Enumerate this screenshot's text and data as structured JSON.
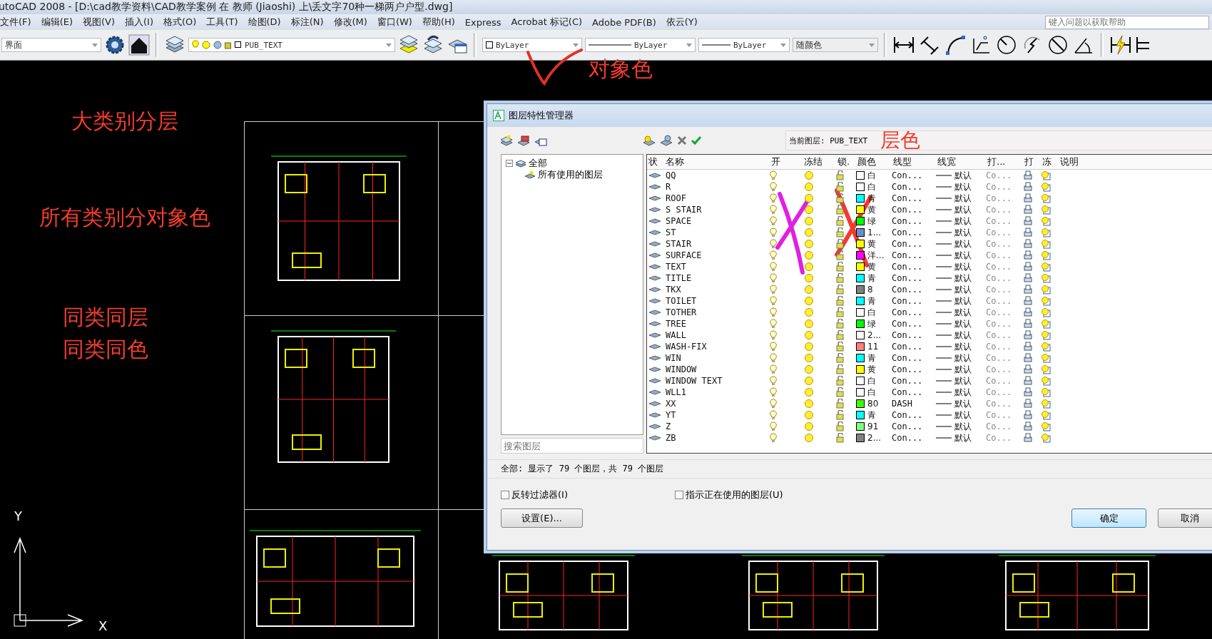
{
  "window": {
    "title": "utoCAD 2008 - [D:\\cad教学资料\\CAD教学案例 在 教师 (Jiaoshi) 上\\丢文字70种一梯两户户型.dwg]"
  },
  "menu": [
    "文件(F)",
    "编辑(E)",
    "视图(V)",
    "插入(I)",
    "格式(O)",
    "工具(T)",
    "绘图(D)",
    "标注(N)",
    "修改(M)",
    "窗口(W)",
    "帮助(H)",
    "Express",
    "Acrobat 标记(C)",
    "Adobe PDF(B)",
    "依云(Y)"
  ],
  "help_search": {
    "placeholder": "键入问题以获取帮助"
  },
  "toolbar": {
    "workspace": "界面",
    "layer": "PUB_TEXT",
    "color_setting": "ByLayer",
    "linetype": "ByLayer",
    "lineweight": "ByLayer",
    "plot_style": "随颜色"
  },
  "annotations": {
    "object_color": "对象色",
    "layer_color": "层色",
    "by_category": "大类别分层",
    "all_by_object_color": "所有类别分对象色",
    "same_layer": "同类同层",
    "same_color": "同类同色"
  },
  "ucs": {
    "x": "X",
    "y": "Y"
  },
  "dialog": {
    "title": "图层特性管理器",
    "current_layer": "当前图层: PUB_TEXT",
    "tree": [
      {
        "label": "全部",
        "expanded": true,
        "children": [
          {
            "label": "所有使用的图层"
          }
        ]
      }
    ],
    "search": {
      "placeholder": "搜索图层"
    },
    "columns": [
      "状",
      "名称",
      "开",
      "冻结",
      "锁.",
      "颜色",
      "线型",
      "线宽",
      "打...",
      "打",
      "冻",
      "说明"
    ],
    "layers": [
      {
        "name": "QQ",
        "color": "#ffffff",
        "color_name": "白",
        "linetype": "Con...",
        "lineweight": "默认",
        "plot_style": "Co..."
      },
      {
        "name": "R",
        "color": "#ffffff",
        "color_name": "白",
        "linetype": "Con...",
        "lineweight": "默认",
        "plot_style": "Co..."
      },
      {
        "name": "ROOF",
        "color": "#00ffff",
        "color_name": "青",
        "linetype": "Con...",
        "lineweight": "默认",
        "plot_style": "Co..."
      },
      {
        "name": "S STAIR",
        "color": "#ffff00",
        "color_name": "黄",
        "linetype": "Con...",
        "lineweight": "默认",
        "plot_style": "Co..."
      },
      {
        "name": "SPACE",
        "color": "#00ff00",
        "color_name": "绿",
        "linetype": "Con...",
        "lineweight": "默认",
        "plot_style": "Co..."
      },
      {
        "name": "ST",
        "color": "#6a8fc8",
        "color_name": "1...",
        "linetype": "Con...",
        "lineweight": "默认",
        "plot_style": "Co..."
      },
      {
        "name": "STAIR",
        "color": "#ffff00",
        "color_name": "黄",
        "linetype": "Con...",
        "lineweight": "默认",
        "plot_style": "Co..."
      },
      {
        "name": "SURFACE",
        "color": "#ff00ff",
        "color_name": "洋...",
        "linetype": "Con...",
        "lineweight": "默认",
        "plot_style": "Co..."
      },
      {
        "name": "TEXT",
        "color": "#ffff00",
        "color_name": "黄",
        "linetype": "Con...",
        "lineweight": "默认",
        "plot_style": "Co..."
      },
      {
        "name": "TITLE",
        "color": "#00ffff",
        "color_name": "青",
        "linetype": "Con...",
        "lineweight": "默认",
        "plot_style": "Co..."
      },
      {
        "name": "TKX",
        "color": "#808080",
        "color_name": "8",
        "linetype": "Con...",
        "lineweight": "默认",
        "plot_style": "Co..."
      },
      {
        "name": "TOILET",
        "color": "#00ffff",
        "color_name": "青",
        "linetype": "Con...",
        "lineweight": "默认",
        "plot_style": "Co..."
      },
      {
        "name": "TOTHER",
        "color": "#ffffff",
        "color_name": "白",
        "linetype": "Con...",
        "lineweight": "默认",
        "plot_style": "Co..."
      },
      {
        "name": "TREE",
        "color": "#00ff00",
        "color_name": "绿",
        "linetype": "Con...",
        "lineweight": "默认",
        "plot_style": "Co..."
      },
      {
        "name": "WALL",
        "color": "#ffffff",
        "color_name": "2...",
        "linetype": "Con...",
        "lineweight": "默认",
        "plot_style": "Co..."
      },
      {
        "name": "WASH-FIX",
        "color": "#ff7f7f",
        "color_name": "11",
        "linetype": "Con...",
        "lineweight": "默认",
        "plot_style": "Co..."
      },
      {
        "name": "WIN",
        "color": "#00ffff",
        "color_name": "青",
        "linetype": "Con...",
        "lineweight": "默认",
        "plot_style": "Co..."
      },
      {
        "name": "WINDOW",
        "color": "#ffff00",
        "color_name": "黄",
        "linetype": "Con...",
        "lineweight": "默认",
        "plot_style": "Co..."
      },
      {
        "name": "WINDOW TEXT",
        "color": "#ffffff",
        "color_name": "白",
        "linetype": "Con...",
        "lineweight": "默认",
        "plot_style": "Co..."
      },
      {
        "name": "WLL1",
        "color": "#ffffff",
        "color_name": "白",
        "linetype": "Con...",
        "lineweight": "默认",
        "plot_style": "Co..."
      },
      {
        "name": "XX",
        "color": "#3fff00",
        "color_name": "80",
        "linetype": "DASH",
        "lineweight": "默认",
        "plot_style": "Co..."
      },
      {
        "name": "YT",
        "color": "#00ffff",
        "color_name": "青",
        "linetype": "Con...",
        "lineweight": "默认",
        "plot_style": "Co..."
      },
      {
        "name": "Z",
        "color": "#7fff7f",
        "color_name": "91",
        "linetype": "Con...",
        "lineweight": "默认",
        "plot_style": "Co..."
      },
      {
        "name": "ZB",
        "color": "#808080",
        "color_name": "2...",
        "linetype": "Con...",
        "lineweight": "默认",
        "plot_style": "Co..."
      }
    ],
    "status": "全部: 显示了 79 个图层，共 79 个图层",
    "checkboxes": [
      {
        "label": "反转过滤器(I)",
        "checked": false
      },
      {
        "label": "指示正在使用的图层(U)",
        "checked": false
      }
    ],
    "buttons": {
      "settings": "设置(E)...",
      "ok": "确定",
      "cancel": "取消"
    }
  }
}
